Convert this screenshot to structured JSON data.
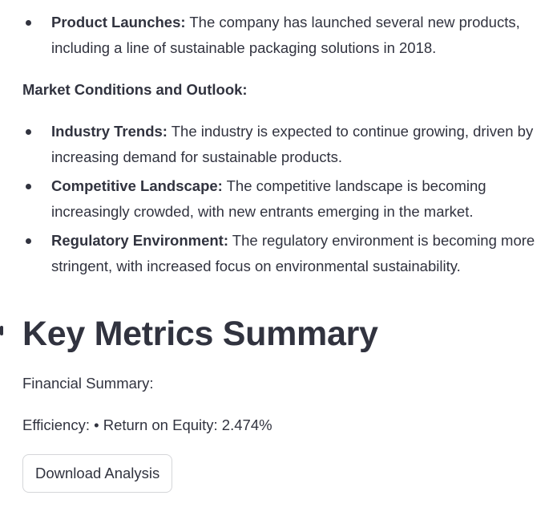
{
  "top_list": {
    "items": [
      {
        "title": "Product Launches:",
        "text": " The company has launched several new products, including a line of sustainable packaging solutions in 2018."
      }
    ]
  },
  "market": {
    "heading": "Market Conditions and Outlook:",
    "items": [
      {
        "title": "Industry Trends:",
        "text": " The industry is expected to continue growing, driven by increasing demand for sustainable products."
      },
      {
        "title": "Competitive Landscape:",
        "text": " The competitive landscape is becoming increasingly crowded, with new entrants emerging in the market."
      },
      {
        "title": "Regulatory Environment:",
        "text": " The regulatory environment is becoming more stringent, with increased focus on environmental sustainability."
      }
    ]
  },
  "metrics": {
    "title": "Key Metrics Summary",
    "financial_summary": "Financial Summary:",
    "efficiency": "Efficiency: • Return on Equity: 2.474%",
    "download_label": "Download Analysis"
  }
}
